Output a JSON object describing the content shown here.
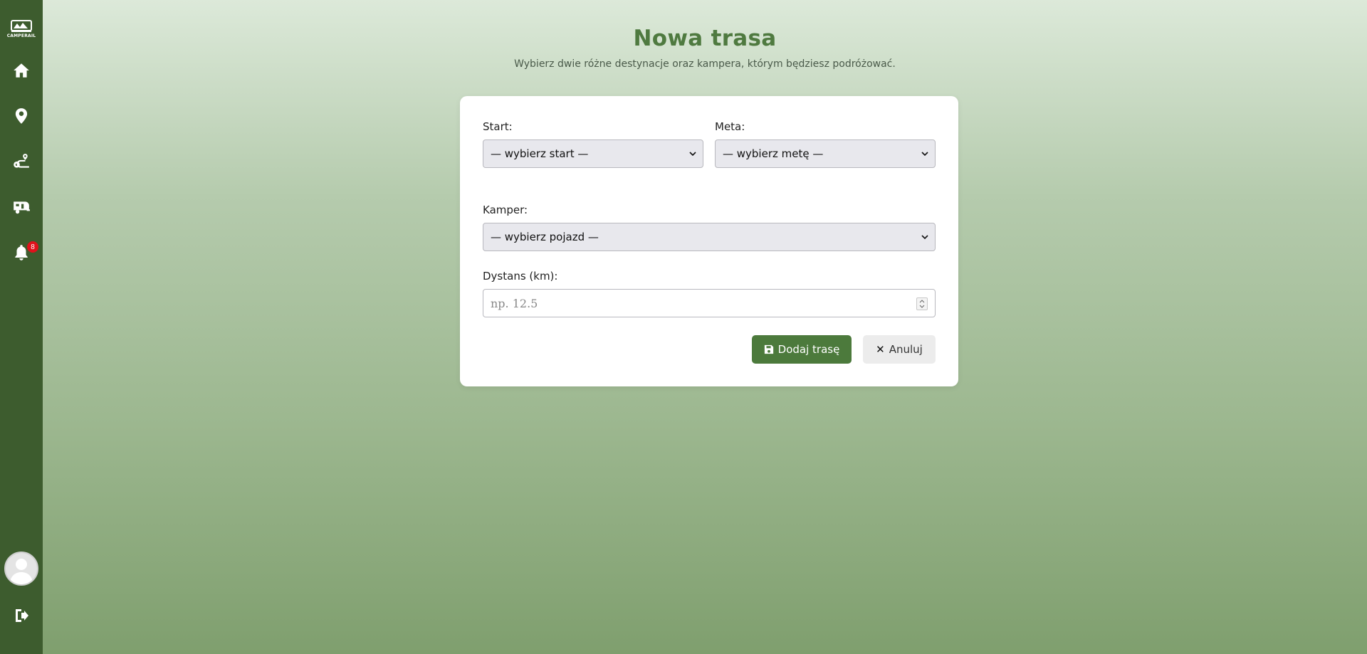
{
  "sidebar": {
    "logo_text": "CAMPERAIL",
    "nav": [
      {
        "icon": "home-icon"
      },
      {
        "icon": "map-pin-icon"
      },
      {
        "icon": "route-icon"
      },
      {
        "icon": "caravan-icon"
      },
      {
        "icon": "bell-icon"
      }
    ],
    "notifications_count": "8",
    "logout_icon": "logout-icon",
    "avatar_icon": "user-avatar-icon"
  },
  "header": {
    "title": "Nowa trasa",
    "subtitle": "Wybierz dwie różne destynacje oraz kampera, którym będziesz podróżować."
  },
  "form": {
    "start_label": "Start:",
    "start_value": "— wybierz start —",
    "meta_label": "Meta:",
    "meta_value": "— wybierz metę —",
    "kamper_label": "Kamper:",
    "kamper_value": "— wybierz pojazd —",
    "distance_label": "Dystans (km):",
    "distance_placeholder": "np. 12.5",
    "submit_label": "Dodaj trasę",
    "cancel_label": "Anuluj"
  },
  "colors": {
    "sidebar": "#3d5c2e",
    "accent": "#4c7a3c",
    "title": "#4f7a40",
    "badge": "#e0111c"
  }
}
